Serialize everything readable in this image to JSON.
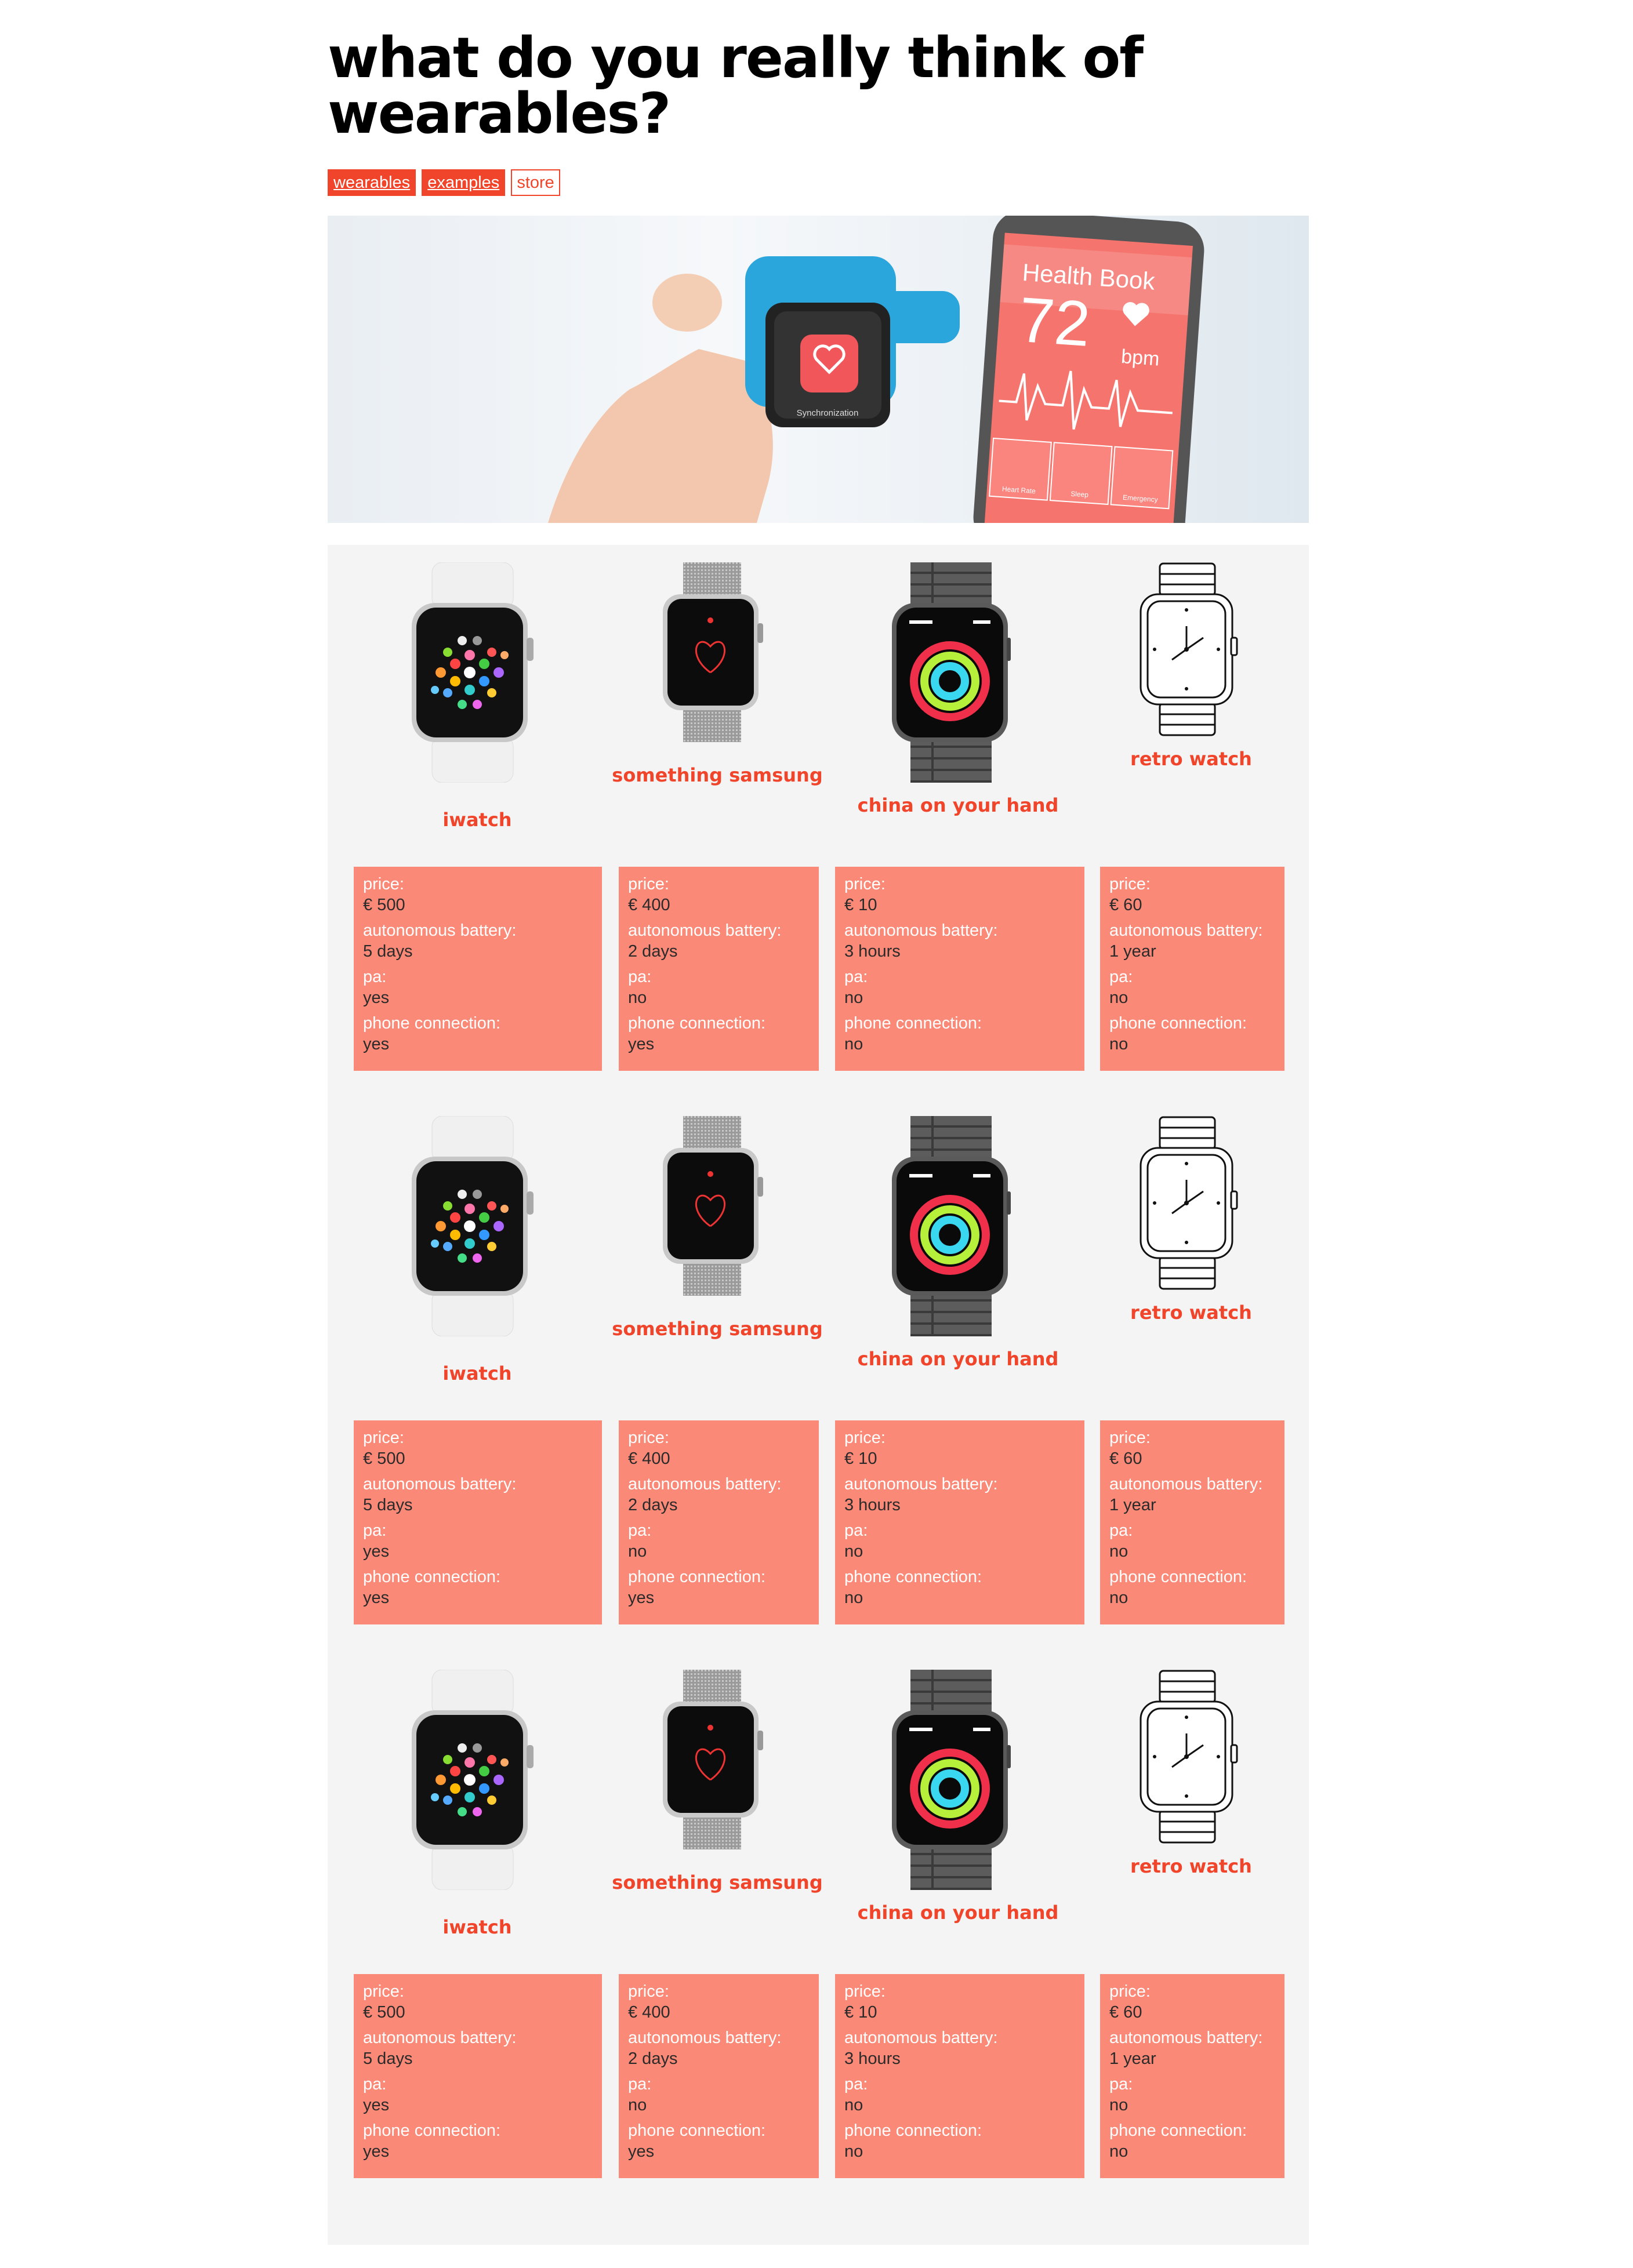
{
  "page": {
    "title_line1": "what do you really think of",
    "title_line2": "wearables?"
  },
  "tags": [
    {
      "label": "wearables",
      "style": "filled"
    },
    {
      "label": "examples",
      "style": "filled"
    },
    {
      "label": "store",
      "style": "outline"
    }
  ],
  "hero": {
    "watch_caption": "Synchronization",
    "phone_app_title": "Health Book",
    "phone_bpm_value": "72",
    "phone_bpm_unit": "bpm",
    "tiles": [
      "Heart Rate",
      "Sleep",
      "Emergency"
    ]
  },
  "spec_labels": {
    "price": "price:",
    "battery": "autonomous battery:",
    "pa": "pa:",
    "phone": "phone connection:"
  },
  "rows": [
    {
      "watches": [
        {
          "name": "iwatch",
          "price": "€ 500",
          "battery": "5 days",
          "pa": "yes",
          "phone": "yes"
        },
        {
          "name": "something samsung",
          "price": "€ 400",
          "battery": "2 days",
          "pa": "no",
          "phone": "yes"
        },
        {
          "name": "china on your hand",
          "price": "€ 10",
          "battery": "3 hours",
          "pa": "no",
          "phone": "no"
        },
        {
          "name": "retro watch",
          "price": "€ 60",
          "battery": "1 year",
          "pa": "no",
          "phone": "no"
        }
      ]
    },
    {
      "watches": [
        {
          "name": "iwatch",
          "price": "€ 500",
          "battery": "5 days",
          "pa": "yes",
          "phone": "yes"
        },
        {
          "name": "something samsung",
          "price": "€ 400",
          "battery": "2 days",
          "pa": "no",
          "phone": "yes"
        },
        {
          "name": "china on your hand",
          "price": "€ 10",
          "battery": "3 hours",
          "pa": "no",
          "phone": "no"
        },
        {
          "name": "retro watch",
          "price": "€ 60",
          "battery": "1 year",
          "pa": "no",
          "phone": "no"
        }
      ]
    },
    {
      "watches": [
        {
          "name": "iwatch",
          "price": "€ 500",
          "battery": "5 days",
          "pa": "yes",
          "phone": "yes"
        },
        {
          "name": "something samsung",
          "price": "€ 400",
          "battery": "2 days",
          "pa": "no",
          "phone": "yes"
        },
        {
          "name": "china on your hand",
          "price": "€ 10",
          "battery": "3 hours",
          "pa": "no",
          "phone": "no"
        },
        {
          "name": "retro watch",
          "price": "€ 60",
          "battery": "1 year",
          "pa": "no",
          "phone": "no"
        }
      ]
    }
  ],
  "colors": {
    "accent": "#f0452b",
    "spec_background": "#fa8977",
    "content_background": "#f4f4f4"
  }
}
